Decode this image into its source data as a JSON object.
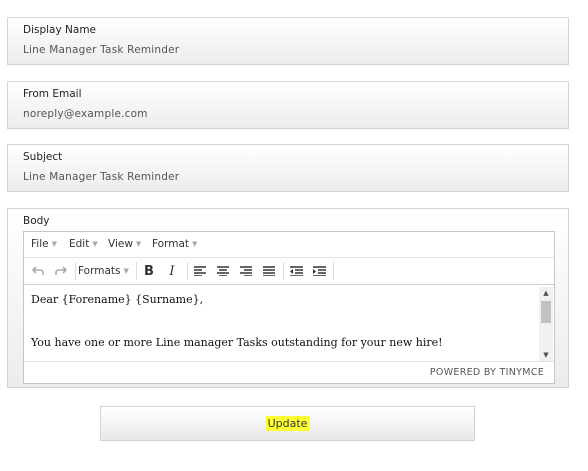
{
  "fields": {
    "display_name": {
      "label": "Display Name",
      "value": "Line Manager Task Reminder"
    },
    "from_email": {
      "label": "From Email",
      "value": "noreply@example.com"
    },
    "subject": {
      "label": "Subject",
      "value": "Line Manager Task Reminder"
    },
    "body": {
      "label": "Body"
    }
  },
  "editor": {
    "menus": [
      "File",
      "Edit",
      "View",
      "Format"
    ],
    "formats_label": "Formats",
    "content": {
      "line1": "Dear {Forename} {Surname},",
      "line2": "You have one or more Line manager Tasks outstanding for your new hire!"
    },
    "powered_by": "POWERED BY TINYMCE",
    "icons": [
      "undo-icon",
      "redo-icon",
      "bold-icon",
      "italic-icon",
      "align-left-icon",
      "align-center-icon",
      "align-right-icon",
      "align-justify-icon",
      "outdent-icon",
      "indent-icon"
    ]
  },
  "update_button": {
    "label": "Update",
    "highlight_color": "#ffff33"
  }
}
